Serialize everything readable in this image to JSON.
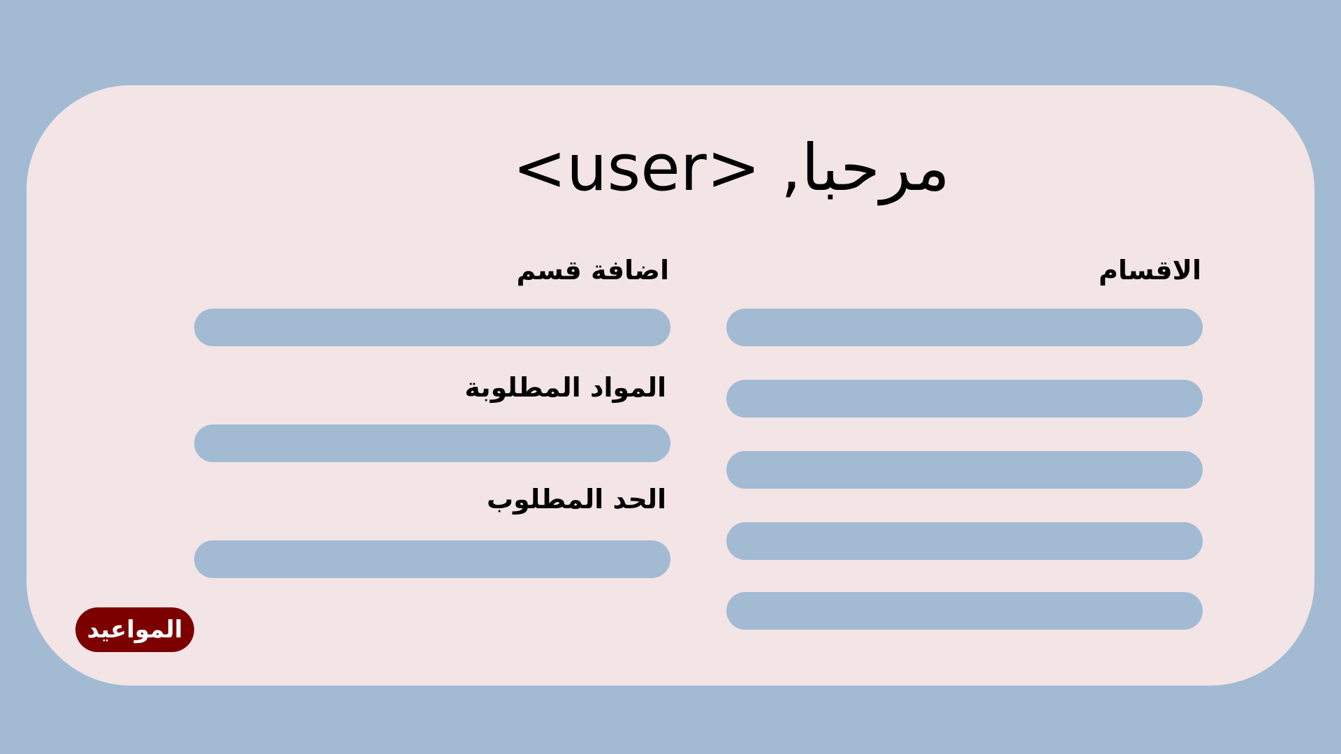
{
  "header": {
    "greeting": "مرحبا, <user>"
  },
  "sections_panel": {
    "title": "الاقسام",
    "list": [
      "",
      "",
      "",
      "",
      ""
    ]
  },
  "add_section_panel": {
    "title": "اضافة قسم",
    "required_materials_label": "المواد المطلوبة",
    "required_limit_label": "الحد المطلوب"
  },
  "appointments_button": {
    "label": "المواعيد"
  },
  "colors": {
    "background": "#a2bbd3",
    "card": "#f3e4e6",
    "field": "#a2bbd3",
    "button": "#7d0000"
  }
}
